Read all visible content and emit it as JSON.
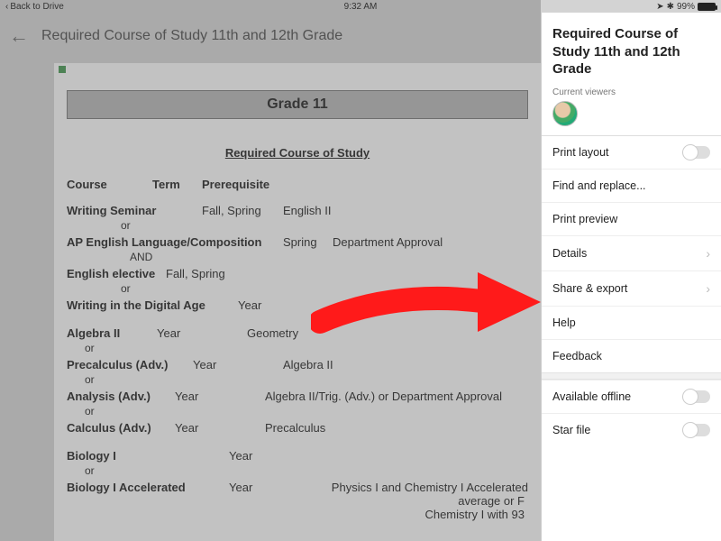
{
  "status": {
    "back": "Back to Drive",
    "time": "9:32 AM",
    "battery": "99%"
  },
  "title": "Required Course of Study 11th and 12th Grade",
  "doc": {
    "grade_header": "Grade 11",
    "section_title": "Required Course of Study",
    "cols": {
      "course": "Course",
      "term": "Term",
      "prereq": "Prerequisite"
    },
    "or": "or",
    "and": "AND",
    "r1": {
      "name": "Writing Seminar",
      "term": "Fall, Spring",
      "prereq": "English II"
    },
    "r2": {
      "name": "AP English Language/Composition",
      "term": "Spring",
      "prereq": "Department Approval"
    },
    "r3": {
      "name": "English elective",
      "term": "Fall, Spring",
      "prereq": ""
    },
    "r4": {
      "name": "Writing in the Digital Age",
      "term": "Year",
      "prereq": ""
    },
    "r5": {
      "name": "Algebra II",
      "term": "Year",
      "prereq": "Geometry"
    },
    "r6": {
      "name": "Precalculus (Adv.)",
      "term": "Year",
      "prereq": "Algebra II"
    },
    "r7": {
      "name": "Analysis (Adv.)",
      "term": "Year",
      "prereq": "Algebra II/Trig. (Adv.) or Department Approval"
    },
    "r8": {
      "name": "Calculus (Adv.)",
      "term": "Year",
      "prereq": "Precalculus"
    },
    "r9": {
      "name": "Biology I",
      "term": "Year",
      "prereq": ""
    },
    "r10": {
      "name": "Biology I Accelerated",
      "term": "Year",
      "prereq_l1": "Physics I and Chemistry I Accelerated",
      "prereq_l2": "average or F",
      "prereq_l3": "Chemistry I with 93"
    }
  },
  "panel": {
    "title": "Required Course of Study 11th and 12th Grade",
    "viewers": "Current viewers",
    "items": {
      "print_layout": "Print layout",
      "find_replace": "Find and replace...",
      "print_preview": "Print preview",
      "details": "Details",
      "share_export": "Share & export",
      "help": "Help",
      "feedback": "Feedback",
      "available_offline": "Available offline",
      "star_file": "Star file"
    }
  }
}
